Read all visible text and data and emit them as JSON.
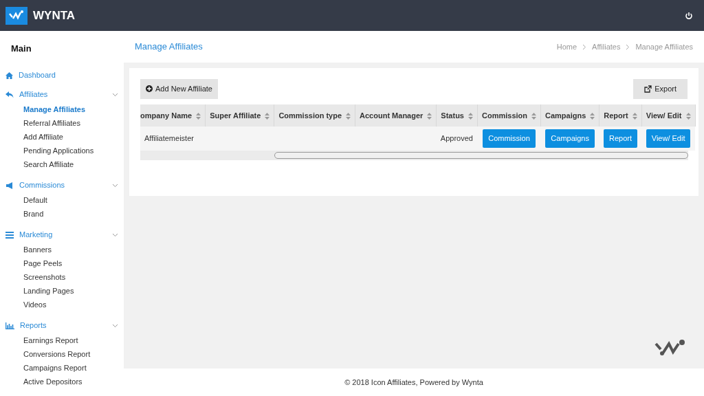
{
  "brand": "WYNTA",
  "sidebar": {
    "title": "Main",
    "sections": [
      {
        "label": "Dashboard"
      },
      {
        "label": "Affiliates",
        "expanded": true,
        "children": [
          {
            "label": "Manage Affiliates",
            "selected": true
          },
          {
            "label": "Referral Affiliates",
            "selected": false
          },
          {
            "label": "Add Affiliate",
            "selected": false
          },
          {
            "label": "Pending Applications",
            "selected": false
          },
          {
            "label": "Search Affiliate",
            "selected": false
          }
        ]
      },
      {
        "label": "Commissions",
        "expanded": true,
        "children": [
          {
            "label": "Default",
            "selected": false
          },
          {
            "label": "Brand",
            "selected": false
          }
        ]
      },
      {
        "label": "Marketing",
        "expanded": true,
        "children": [
          {
            "label": "Banners",
            "selected": false
          },
          {
            "label": "Page Peels",
            "selected": false
          },
          {
            "label": "Screenshots",
            "selected": false
          },
          {
            "label": "Landing Pages",
            "selected": false
          },
          {
            "label": "Videos",
            "selected": false
          }
        ]
      },
      {
        "label": "Reports",
        "expanded": true,
        "children": [
          {
            "label": "Earnings Report",
            "selected": false
          },
          {
            "label": "Conversions Report",
            "selected": false
          },
          {
            "label": "Campaigns Report",
            "selected": false
          },
          {
            "label": "Active Depositors",
            "selected": false
          }
        ]
      }
    ]
  },
  "page_title": "Manage Affiliates",
  "breadcrumb": [
    "Home",
    "Affiliates",
    "Manage Affiliates"
  ],
  "add_button": "Add New Affiliate",
  "export_button": "Export",
  "table": {
    "columns": [
      "ompany Name",
      "Super Affiliate",
      "Commission type",
      "Account Manager",
      "Status",
      "Commission",
      "Campaigns",
      "Report",
      "View/ Edit"
    ],
    "rows": [
      {
        "cells": [
          {
            "kind": "text",
            "text": "Affiliatemeister"
          },
          {
            "kind": "blank"
          },
          {
            "kind": "blank"
          },
          {
            "kind": "blank"
          },
          {
            "kind": "text",
            "text": "Approved"
          },
          {
            "kind": "button",
            "text": "Commission"
          },
          {
            "kind": "button",
            "text": "Campaigns"
          },
          {
            "kind": "button",
            "text": "Report"
          },
          {
            "kind": "button",
            "text": "View/ Edit"
          }
        ]
      }
    ]
  },
  "footer": "© 2018 Icon Affiliates, Powered by Wynta"
}
